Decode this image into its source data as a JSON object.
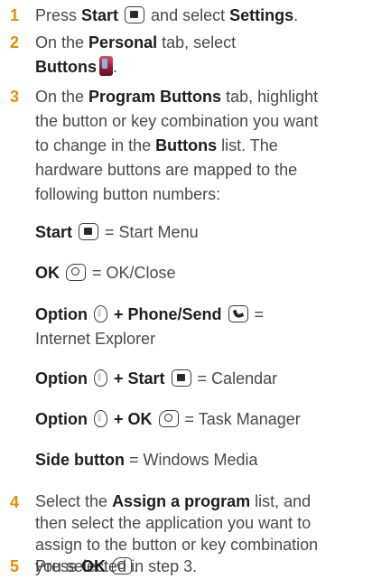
{
  "steps": [
    {
      "number": "1",
      "press": "Press ",
      "start": "Start",
      "select": " and select ",
      "settings": "Settings",
      "period": "."
    },
    {
      "number": "2",
      "on_the": "On the ",
      "personal": "Personal",
      "tab_select": " tab, select",
      "buttons": "Buttons",
      "period": "."
    },
    {
      "number": "3",
      "line1a": "On the ",
      "program_buttons": "Program Buttons",
      "line1b": " tab, highlight",
      "line2": "the button or key combination you want",
      "line3a": "to change in the ",
      "buttons": "Buttons",
      "line3b": " list. The",
      "line4": "hardware buttons are mapped to the",
      "line5": "following button numbers:",
      "mappings": {
        "start_label": "Start",
        "start_value": " = Start Menu",
        "ok_label": "OK",
        "ok_value": " = OK/Close",
        "option_label": "Option",
        "phone_send_label": " + Phone/Send",
        "phone_eq": " =",
        "phone_value": "Internet Explorer",
        "opt_start_label": " + Start",
        "opt_start_value": " = Calendar",
        "opt_ok_label": " + OK",
        "opt_ok_value": " = Task Manager",
        "side_label": "Side button",
        "side_value": " = Windows Media"
      }
    },
    {
      "number": "4",
      "line1a": "Select the ",
      "assign": "Assign a program",
      "line1b": " list, and",
      "line2": "then select the application you want to",
      "line3": "assign to the button or key combination",
      "line4": "you selected in step 3."
    },
    {
      "number": "5",
      "press": "Press ",
      "ok": "OK",
      "period": "."
    }
  ],
  "icons": {
    "start_key": "windows-start-key-icon",
    "ok_key": "ok-key-icon",
    "option_key": "option-key-icon",
    "phone_key": "phone-send-key-icon",
    "buttons_app": "buttons-settings-icon"
  }
}
